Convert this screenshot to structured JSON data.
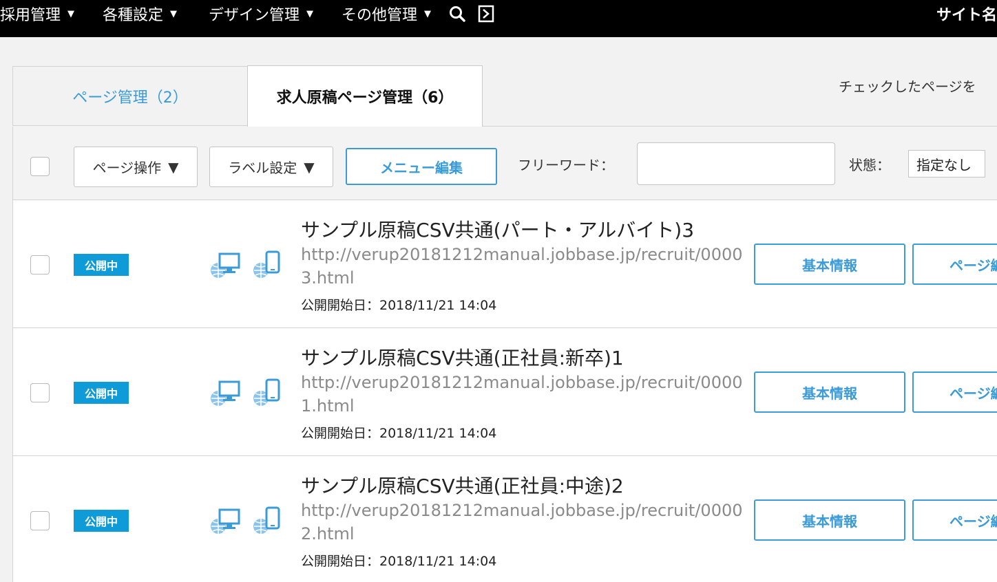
{
  "nav": {
    "items": [
      {
        "label": "採用管理"
      },
      {
        "label": "各種設定"
      },
      {
        "label": "デザイン管理"
      },
      {
        "label": "その他管理"
      }
    ],
    "caret": "▼",
    "site_name": "サイト名",
    "icons": [
      "search-icon",
      "logout-icon"
    ]
  },
  "tabs": [
    {
      "label": "ページ管理（2）",
      "active": false
    },
    {
      "label": "求人原稿ページ管理（6）",
      "active": true
    }
  ],
  "check_caption": "チェックしたページを",
  "toolbar": {
    "page_ops_label": "ページ操作",
    "label_settings_label": "ラベル設定",
    "dropdown_arrow": "▼",
    "menu_edit_label": "メニュー編集",
    "freeword_label": "フリーワード：",
    "freeword_value": "",
    "status_label": "状態：",
    "status_value": "指定なし"
  },
  "rows": [
    {
      "status": "公開中",
      "title": "サンプル原稿CSV共通(パート・アルバイト)3",
      "url": "http://verup20181212manual.jobbase.jp/recruit/00003.html",
      "date": "公開開始日：2018/11/21 14:04",
      "basic_button": "基本情報",
      "page_button": "ページ編"
    },
    {
      "status": "公開中",
      "title": "サンプル原稿CSV共通(正社員:新卒)1",
      "url": "http://verup20181212manual.jobbase.jp/recruit/00001.html",
      "date": "公開開始日：2018/11/21 14:04",
      "basic_button": "基本情報",
      "page_button": "ページ編"
    },
    {
      "status": "公開中",
      "title": "サンプル原稿CSV共通(正社員:中途)2",
      "url": "http://verup20181212manual.jobbase.jp/recruit/00002.html",
      "date": "公開開始日：2018/11/21 14:04",
      "basic_button": "基本情報",
      "page_button": "ページ編"
    }
  ],
  "colors": {
    "accent": "#3a9bd8",
    "badge": "#0f9bd7",
    "nav_bg": "#000000"
  }
}
